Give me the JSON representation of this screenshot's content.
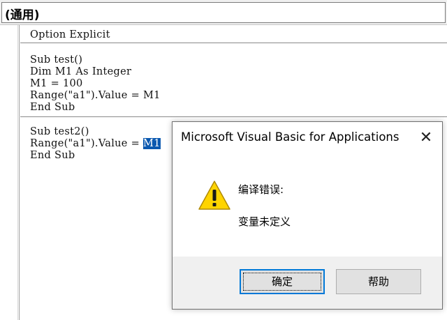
{
  "object_combo": {
    "value": "(通用)"
  },
  "code": {
    "lines": [
      "Option Explicit",
      "Sub test()",
      "Dim M1 As Integer",
      "M1 = 100",
      "Range(\"a1\").Value = M1",
      "End Sub",
      "Sub test2()",
      "Range(\"a1\").Value = ",
      "End Sub"
    ],
    "selected_token": "M1"
  },
  "dialog": {
    "title": "Microsoft Visual Basic for Applications",
    "close_glyph": "✕",
    "icon": "warning-icon",
    "heading": "编译错误:",
    "message": "变量未定义",
    "ok_label": "确定",
    "help_label": "帮助"
  },
  "colors": {
    "selection": "#0a58b0",
    "focus_border": "#0078d7",
    "warning_fill": "#ffd400"
  }
}
